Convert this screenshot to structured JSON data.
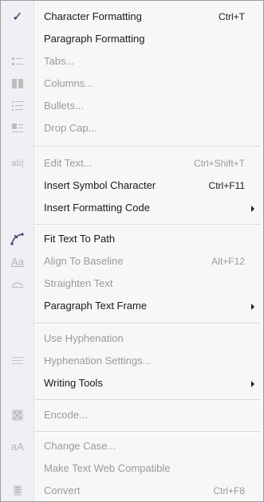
{
  "menu": {
    "items": [
      {
        "label": "Character Formatting",
        "shortcut": "Ctrl+T",
        "icon": "checkmark-icon"
      },
      {
        "label": "Paragraph Formatting",
        "shortcut": ""
      },
      {
        "label": "Tabs...",
        "icon": "tabs-icon"
      },
      {
        "label": "Columns...",
        "icon": "columns-icon"
      },
      {
        "label": "Bullets...",
        "icon": "bullets-icon"
      },
      {
        "label": "Drop Cap...",
        "icon": "drop-cap-icon"
      },
      {
        "label": "Edit Text...",
        "shortcut": "Ctrl+Shift+T",
        "icon": "edit-text-icon"
      },
      {
        "label": "Insert Symbol Character",
        "shortcut": "Ctrl+F11"
      },
      {
        "label": "Insert Formatting Code"
      },
      {
        "label": "Fit Text To Path",
        "icon": "fit-text-to-path-icon"
      },
      {
        "label": "Align To Baseline",
        "shortcut": "Alt+F12",
        "icon": "align-baseline-icon"
      },
      {
        "label": "Straighten Text",
        "icon": "straighten-text-icon"
      },
      {
        "label": "Paragraph Text Frame"
      },
      {
        "label": "Use Hyphenation"
      },
      {
        "label": "Hyphenation Settings...",
        "icon": "hyphenation-settings-icon"
      },
      {
        "label": "Writing Tools"
      },
      {
        "label": "Encode...",
        "icon": "encode-icon"
      },
      {
        "label": "Change Case...",
        "icon": "change-case-icon"
      },
      {
        "label": "Make Text Web Compatible"
      },
      {
        "label": "Convert",
        "shortcut": "Ctrl+F8",
        "icon": "convert-icon"
      }
    ]
  },
  "icon_glyphs": {
    "align": "Aa",
    "case": "aA",
    "edit": "ab|"
  }
}
